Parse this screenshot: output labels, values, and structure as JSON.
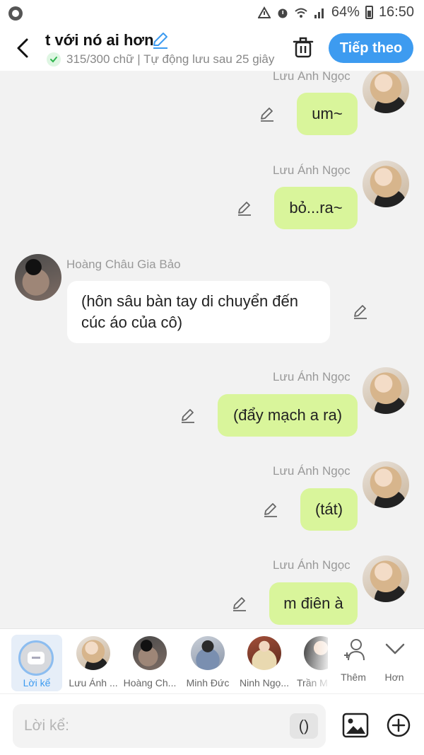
{
  "status_bar": {
    "battery": "64%",
    "time": "16:50"
  },
  "header": {
    "title": "t với nó ai hơn",
    "status": "315/300 chữ | Tự động lưu sau 25 giây",
    "next_label": "Tiếp theo"
  },
  "messages": [
    {
      "sender": "Lưu Ánh Ngọc",
      "text": "um~",
      "side": "right"
    },
    {
      "sender": "Lưu Ánh Ngọc",
      "text": "bỏ...ra~",
      "side": "right"
    },
    {
      "sender": "Hoàng Châu Gia Bảo",
      "text": "(hôn sâu bàn tay di chuyển đến cúc áo của cô)",
      "side": "left"
    },
    {
      "sender": "Lưu Ánh Ngọc",
      "text": "(đẩy mạch a ra)",
      "side": "right"
    },
    {
      "sender": "Lưu Ánh Ngọc",
      "text": "(tát)",
      "side": "right"
    },
    {
      "sender": "Lưu Ánh Ngọc",
      "text": "m điên à",
      "side": "right"
    }
  ],
  "characters": {
    "narration": "Lời kể",
    "list": [
      "Lưu Ánh ...",
      "Hoàng Ch...",
      "Minh Đức",
      "Ninh Ngọ...",
      "Trần M"
    ],
    "add_label": "Thêm",
    "more_label": "Hơn"
  },
  "composer": {
    "placeholder": "Lời kể:",
    "paren_label": "()"
  },
  "colors": {
    "accent": "#3d9bf0",
    "bubble_right": "#d9f59b",
    "bubble_left": "#ffffff"
  }
}
